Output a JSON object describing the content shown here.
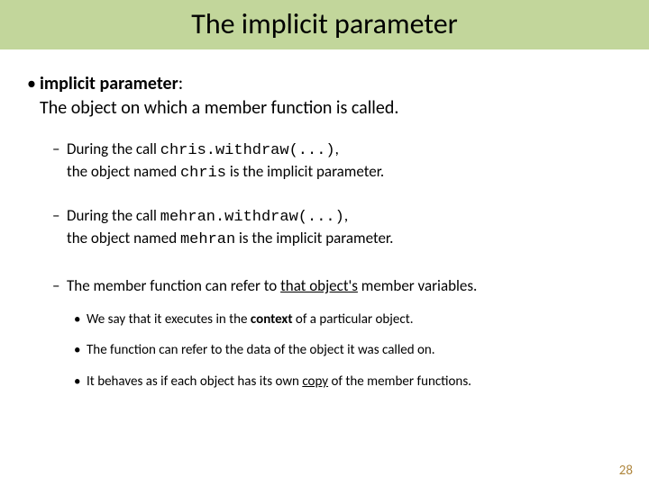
{
  "title": "The implicit parameter",
  "def": {
    "term": "implicit parameter",
    "rest": ":",
    "desc": "The object on which a member function is called."
  },
  "ex1": {
    "pre": "During the call ",
    "code": "chris.withdraw(...)",
    "post": ",",
    "line2a": "the object named ",
    "line2code": "chris",
    "line2b": " is the implicit parameter."
  },
  "ex2": {
    "pre": "During the call ",
    "code": "mehran.withdraw(...)",
    "post": ",",
    "line2a": "the object named ",
    "line2code": "mehran",
    "line2b": " is the implicit parameter."
  },
  "refer": {
    "a": "The member function can refer to ",
    "u": "that object's",
    "b": " member variables."
  },
  "sub1": {
    "a": "We say that it executes in the ",
    "bold": "context",
    "b": " of a particular object."
  },
  "sub2": "The function can refer to the data of the object it was called on.",
  "sub3": {
    "a": "It behaves as if each object has its own ",
    "u": "copy",
    "b": " of the member functions."
  },
  "page": "28"
}
